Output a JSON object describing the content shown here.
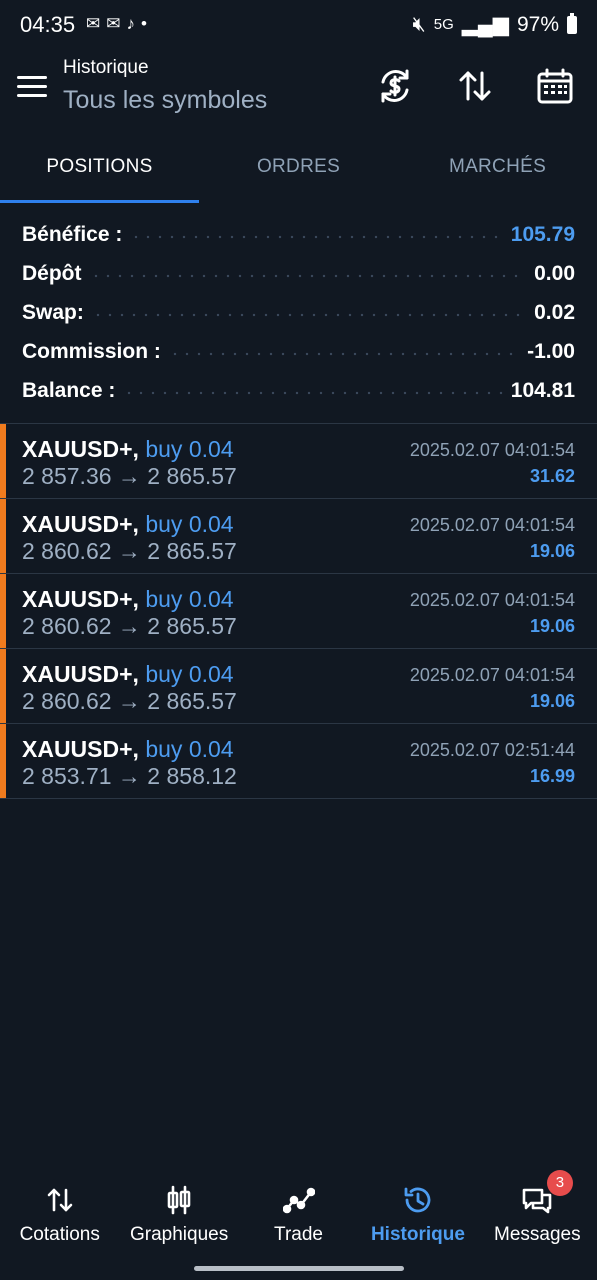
{
  "status_bar": {
    "time": "04:35",
    "notification_dot": "•",
    "network": "5G",
    "battery": "97%"
  },
  "header": {
    "title": "Historique",
    "subtitle": "Tous les symboles"
  },
  "tabs": [
    {
      "label": "POSITIONS",
      "active": true
    },
    {
      "label": "ORDRES",
      "active": false
    },
    {
      "label": "MARCHÉS",
      "active": false
    }
  ],
  "summary": [
    {
      "label": "Bénéfice :",
      "value": "105.79",
      "highlight": true
    },
    {
      "label": "Dépôt",
      "value": "0.00",
      "highlight": false
    },
    {
      "label": "Swap:",
      "value": "0.02",
      "highlight": false
    },
    {
      "label": "Commission :",
      "value": "-1.00",
      "highlight": false
    },
    {
      "label": "Balance :",
      "value": "104.81",
      "highlight": false
    }
  ],
  "trades": [
    {
      "symbol": "XAUUSD+,",
      "side": "buy 0.04",
      "prices": "2 857.36 → 2 865.57",
      "datetime": "2025.02.07 04:01:54",
      "profit": "31.62"
    },
    {
      "symbol": "XAUUSD+,",
      "side": "buy 0.04",
      "prices": "2 860.62 → 2 865.57",
      "datetime": "2025.02.07 04:01:54",
      "profit": "19.06"
    },
    {
      "symbol": "XAUUSD+,",
      "side": "buy 0.04",
      "prices": "2 860.62 → 2 865.57",
      "datetime": "2025.02.07 04:01:54",
      "profit": "19.06"
    },
    {
      "symbol": "XAUUSD+,",
      "side": "buy 0.04",
      "prices": "2 860.62 → 2 865.57",
      "datetime": "2025.02.07 04:01:54",
      "profit": "19.06"
    },
    {
      "symbol": "XAUUSD+,",
      "side": "buy 0.04",
      "prices": "2 853.71 → 2 858.12",
      "datetime": "2025.02.07 02:51:44",
      "profit": "16.99"
    }
  ],
  "bottom_nav": [
    {
      "label": "Cotations",
      "icon": "arrows-updown-icon",
      "active": false
    },
    {
      "label": "Graphiques",
      "icon": "candles-icon",
      "active": false
    },
    {
      "label": "Trade",
      "icon": "trend-icon",
      "active": false
    },
    {
      "label": "Historique",
      "icon": "history-icon",
      "active": true
    },
    {
      "label": "Messages",
      "icon": "chat-icon",
      "active": false,
      "badge": "3"
    }
  ],
  "colors": {
    "background": "#111822",
    "accent": "#4d9cf0",
    "position_marker": "#f07b1e",
    "badge": "#e74c4c"
  }
}
